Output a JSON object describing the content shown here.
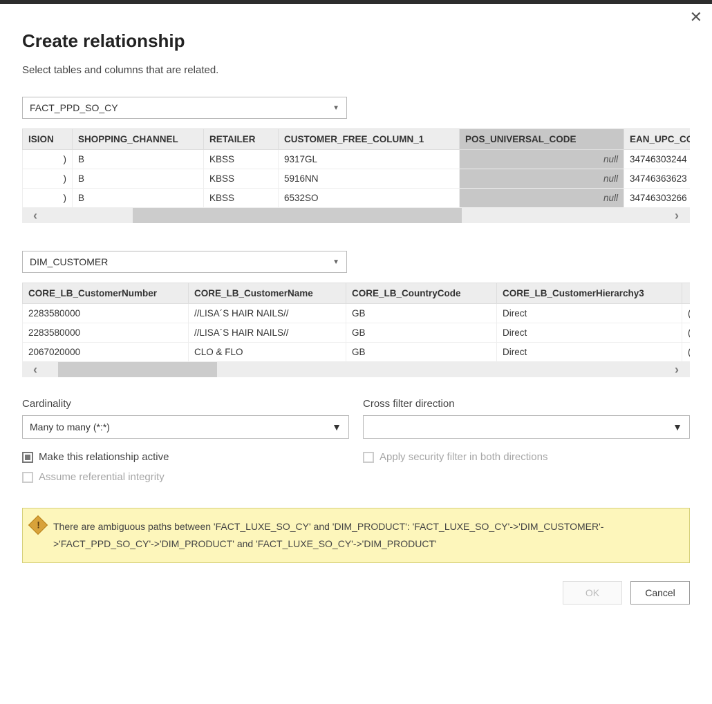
{
  "dialog": {
    "title": "Create relationship",
    "subtitle": "Select tables and columns that are related."
  },
  "table1": {
    "name": "FACT_PPD_SO_CY",
    "columns": [
      "ISION",
      "SHOPPING_CHANNEL",
      "RETAILER",
      "CUSTOMER_FREE_COLUMN_1",
      "POS_UNIVERSAL_CODE",
      "EAN_UPC_CO"
    ],
    "selected_column_index": 4,
    "rows": [
      {
        "ISION": ")",
        "SHOPPING_CHANNEL": "B",
        "RETAILER": "KBSS",
        "CUSTOMER_FREE_COLUMN_1": "9317GL",
        "POS_UNIVERSAL_CODE": "null",
        "EAN_UPC_CO": "34746303244"
      },
      {
        "ISION": ")",
        "SHOPPING_CHANNEL": "B",
        "RETAILER": "KBSS",
        "CUSTOMER_FREE_COLUMN_1": "5916NN",
        "POS_UNIVERSAL_CODE": "null",
        "EAN_UPC_CO": "34746363623"
      },
      {
        "ISION": ")",
        "SHOPPING_CHANNEL": "B",
        "RETAILER": "KBSS",
        "CUSTOMER_FREE_COLUMN_1": "6532SO",
        "POS_UNIVERSAL_CODE": "null",
        "EAN_UPC_CO": "34746303266"
      }
    ]
  },
  "table2": {
    "name": "DIM_CUSTOMER",
    "columns": [
      "CORE_LB_CustomerNumber",
      "CORE_LB_CustomerName",
      "CORE_LB_CountryCode",
      "CORE_LB_CustomerHierarchy3",
      ""
    ],
    "rows": [
      {
        "c0": "2283580000",
        "c1": "//LISA´S HAIR NAILS//",
        "c2": "GB",
        "c3": "Direct",
        "c4": "("
      },
      {
        "c0": "2283580000",
        "c1": "//LISA´S HAIR NAILS//",
        "c2": "GB",
        "c3": "Direct",
        "c4": "("
      },
      {
        "c0": "2067020000",
        "c1": "CLO & FLO",
        "c2": "GB",
        "c3": "Direct",
        "c4": "("
      }
    ]
  },
  "options": {
    "cardinality_label": "Cardinality",
    "cardinality_value": "Many to many (*:*)",
    "crossfilter_label": "Cross filter direction",
    "crossfilter_value": "",
    "make_active": "Make this relationship active",
    "apply_security": "Apply security filter in both directions",
    "assume_ref": "Assume referential integrity"
  },
  "warning": "There are ambiguous paths between 'FACT_LUXE_SO_CY' and 'DIM_PRODUCT': 'FACT_LUXE_SO_CY'->'DIM_CUSTOMER'->'FACT_PPD_SO_CY'->'DIM_PRODUCT' and 'FACT_LUXE_SO_CY'->'DIM_PRODUCT'",
  "buttons": {
    "ok": "OK",
    "cancel": "Cancel"
  }
}
